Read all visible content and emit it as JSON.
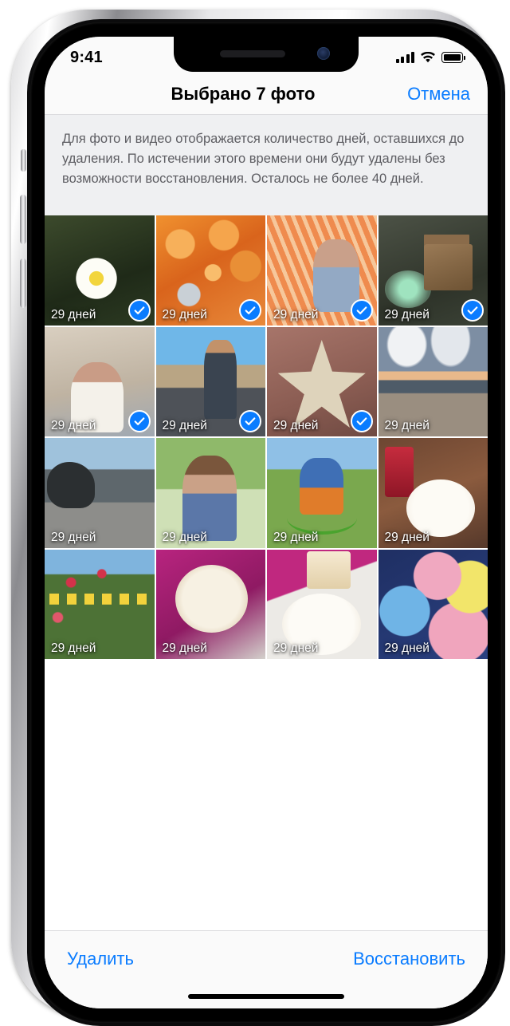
{
  "status_bar": {
    "time": "9:41",
    "signal_icon": "cellular-bars-icon",
    "wifi_icon": "wifi-icon",
    "battery_icon": "battery-full-icon"
  },
  "nav": {
    "title": "Выбрано 7 фото",
    "cancel_label": "Отмена"
  },
  "description": {
    "text": "Для фото и видео отображается количество дней, оставшихся до удаления. По истечении этого времени они будут удалены без возможности восстановления. Осталось не более 40 дней."
  },
  "grid": {
    "photos": [
      {
        "subject": "daisy-flower",
        "days_label": "29 дней",
        "selected": true,
        "art": "a-daisy"
      },
      {
        "subject": "child-in-pumpkins",
        "days_label": "29 дней",
        "selected": true,
        "art": "a-pumpkin"
      },
      {
        "subject": "girl-in-hammock",
        "days_label": "29 дней",
        "selected": true,
        "art": "a-hammock2"
      },
      {
        "subject": "wooden-birdhouse",
        "days_label": "29 дней",
        "selected": true,
        "art": "a-birdhouse"
      },
      {
        "subject": "woman-in-village",
        "days_label": "29 дней",
        "selected": true,
        "art": "a-village"
      },
      {
        "subject": "surfer-with-board",
        "days_label": "29 дней",
        "selected": true,
        "art": "a-surf"
      },
      {
        "subject": "starfish-on-rock",
        "days_label": "29 дней",
        "selected": true,
        "art": "a-star"
      },
      {
        "subject": "beach-at-dusk",
        "days_label": "29 дней",
        "selected": false,
        "art": "a-beach"
      },
      {
        "subject": "rocky-shoreline",
        "days_label": "29 дней",
        "selected": false,
        "art": "a-rocks"
      },
      {
        "subject": "boy-in-plaid-shirt",
        "days_label": "29 дней",
        "selected": false,
        "art": "a-boy"
      },
      {
        "subject": "cyclist-on-trail",
        "days_label": "29 дней",
        "selected": false,
        "art": "a-bike"
      },
      {
        "subject": "cake-slice-on-plate",
        "days_label": "29 дней",
        "selected": false,
        "art": "a-cake1"
      },
      {
        "subject": "garland-in-garden",
        "days_label": "29 дней",
        "selected": false,
        "art": "a-garland"
      },
      {
        "subject": "layer-cake-on-pink",
        "days_label": "29 дней",
        "selected": false,
        "art": "a-cake2"
      },
      {
        "subject": "cake-on-dotted-plate",
        "days_label": "29 дней",
        "selected": false,
        "art": "a-cake3"
      },
      {
        "subject": "party-balloons",
        "days_label": "29 дней",
        "selected": false,
        "art": "a-balloons"
      }
    ]
  },
  "toolbar": {
    "delete_label": "Удалить",
    "recover_label": "Восстановить"
  },
  "colors": {
    "accent_blue": "#0a7cff",
    "nav_background": "#fafafa",
    "description_background": "#eff0f2"
  }
}
